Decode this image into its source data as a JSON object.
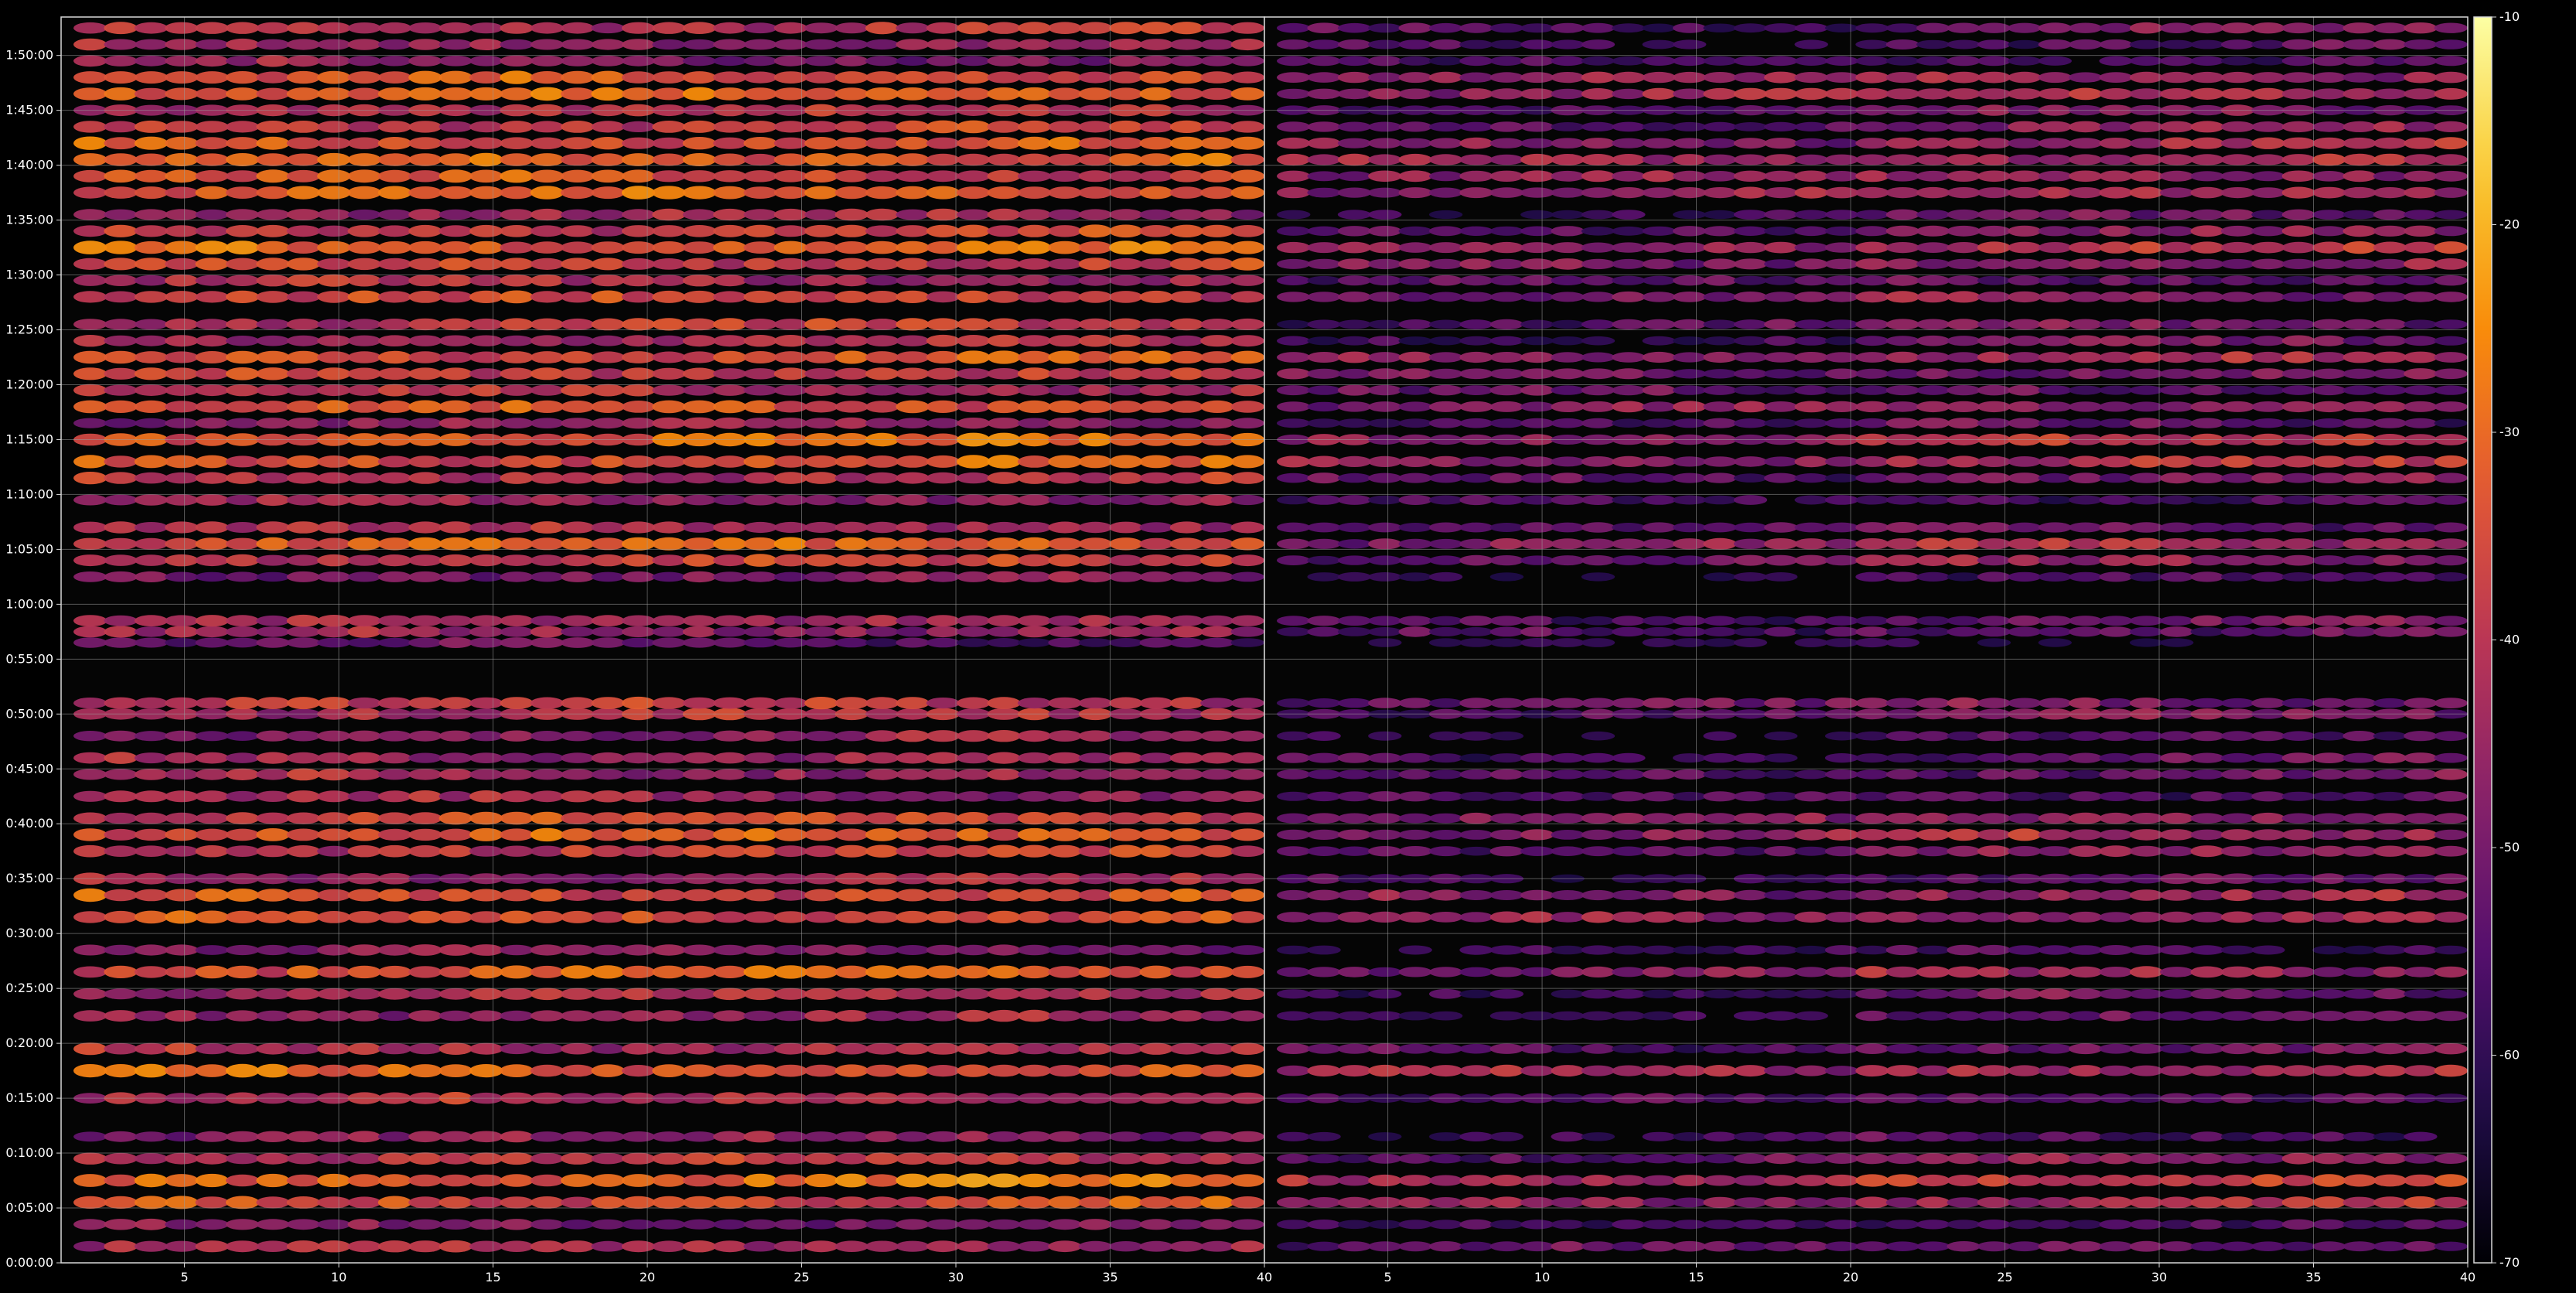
{
  "chart_data": [
    {
      "type": "heatmap",
      "panel": "left",
      "x_ticks": [
        "5",
        "10",
        "15",
        "20",
        "25",
        "30",
        "35",
        "40"
      ],
      "x_tick_values": [
        5,
        10,
        15,
        20,
        25,
        30,
        35,
        40
      ],
      "xlim": [
        1,
        40
      ],
      "y_ticks": [
        "0:00:00",
        "0:05:00",
        "0:10:00",
        "0:15:00",
        "0:20:00",
        "0:25:00",
        "0:30:00",
        "0:35:00",
        "0:40:00",
        "0:45:00",
        "0:50:00",
        "0:55:00",
        "1:00:00",
        "1:05:00",
        "1:10:00",
        "1:15:00",
        "1:20:00",
        "1:25:00",
        "1:30:00",
        "1:35:00",
        "1:40:00",
        "1:45:00",
        "1:50:00"
      ],
      "ylim_minutes": [
        0,
        113.5
      ],
      "grid": true,
      "rows_minutes": [
        1.5,
        3.5,
        5.5,
        7.5,
        9.5,
        11.5,
        15,
        17.5,
        19.5,
        22.5,
        24.5,
        26.5,
        28.5,
        31.5,
        33.5,
        35,
        37.5,
        39,
        40.5,
        42.5,
        44.5,
        46,
        48,
        50,
        51,
        56.5,
        57.5,
        58.5,
        62.5,
        64,
        65.5,
        67,
        69.5,
        71.5,
        73,
        75,
        76.5,
        78,
        79.5,
        81,
        82.5,
        84,
        85.5,
        88,
        89.5,
        91,
        92.5,
        94,
        95.5,
        97.5,
        99,
        100.5,
        102,
        103.5,
        105,
        106.5,
        108,
        109.5,
        111,
        112.5
      ],
      "row_levels_dB": [
        -43,
        -49,
        -34,
        -30,
        -40,
        -47,
        -42,
        -33,
        -41,
        -45,
        -41,
        -33,
        -48,
        -34,
        -35,
        -44,
        -38,
        -33,
        -36,
        -44,
        -43,
        -44,
        -46,
        -41,
        -39,
        -54,
        -45,
        -43,
        -49,
        -38,
        -33,
        -42,
        -46,
        -40,
        -33,
        -32,
        -45,
        -34,
        -41,
        -38,
        -34,
        -43,
        -40,
        -37,
        -43,
        -37,
        -30,
        -38,
        -44,
        -32,
        -35,
        -31,
        -33,
        -38,
        -41,
        -31,
        -34,
        -47,
        -45,
        -41
      ]
    },
    {
      "type": "heatmap",
      "panel": "right",
      "x_ticks": [
        "5",
        "10",
        "15",
        "20",
        "25",
        "30",
        "35",
        "40"
      ],
      "x_tick_values": [
        5,
        10,
        15,
        20,
        25,
        30,
        35,
        40
      ],
      "xlim": [
        1,
        40
      ],
      "ylim_minutes": [
        0,
        113.5
      ],
      "grid": true,
      "rows_minutes": [
        1.5,
        3.5,
        5.5,
        7.5,
        9.5,
        11.5,
        15,
        17.5,
        19.5,
        22.5,
        24.5,
        26.5,
        28.5,
        31.5,
        33.5,
        35,
        37.5,
        39,
        40.5,
        42.5,
        44.5,
        46,
        48,
        50,
        51,
        56.5,
        57.5,
        58.5,
        62.5,
        64,
        65.5,
        67,
        69.5,
        71.5,
        73,
        75,
        76.5,
        78,
        79.5,
        81,
        82.5,
        84,
        85.5,
        88,
        89.5,
        91,
        92.5,
        94,
        95.5,
        97.5,
        99,
        100.5,
        102,
        103.5,
        105,
        106.5,
        108,
        109.5,
        111,
        112.5
      ],
      "row_levels_dB": [
        -50,
        -55,
        -42,
        -38,
        -48,
        -55,
        -52,
        -41,
        -51,
        -53,
        -52,
        -45,
        -56,
        -43,
        -44,
        -53,
        -48,
        -43,
        -46,
        -53,
        -51,
        -53,
        -56,
        -49,
        -48,
        -62,
        -52,
        -52,
        -57,
        -47,
        -43,
        -51,
        -55,
        -49,
        -42,
        -41,
        -53,
        -45,
        -50,
        -48,
        -44,
        -52,
        -50,
        -47,
        -51,
        -46,
        -40,
        -48,
        -53,
        -42,
        -44,
        -41,
        -43,
        -48,
        -50,
        -41,
        -44,
        -55,
        -54,
        -50
      ]
    }
  ],
  "colorbar": {
    "colormap": "inferno",
    "ticks": [
      "-10",
      "-20",
      "-30",
      "-40",
      "-50",
      "-60",
      "-70"
    ],
    "tick_values": [
      -10,
      -20,
      -30,
      -40,
      -50,
      -60,
      -70
    ],
    "vmin": -70,
    "vmax": -10
  },
  "colors": {
    "background": "#000000",
    "axes_face": "#050505",
    "spine": "#d8d8d8",
    "grid": "#9a9a9a",
    "text": "#ffffff"
  }
}
